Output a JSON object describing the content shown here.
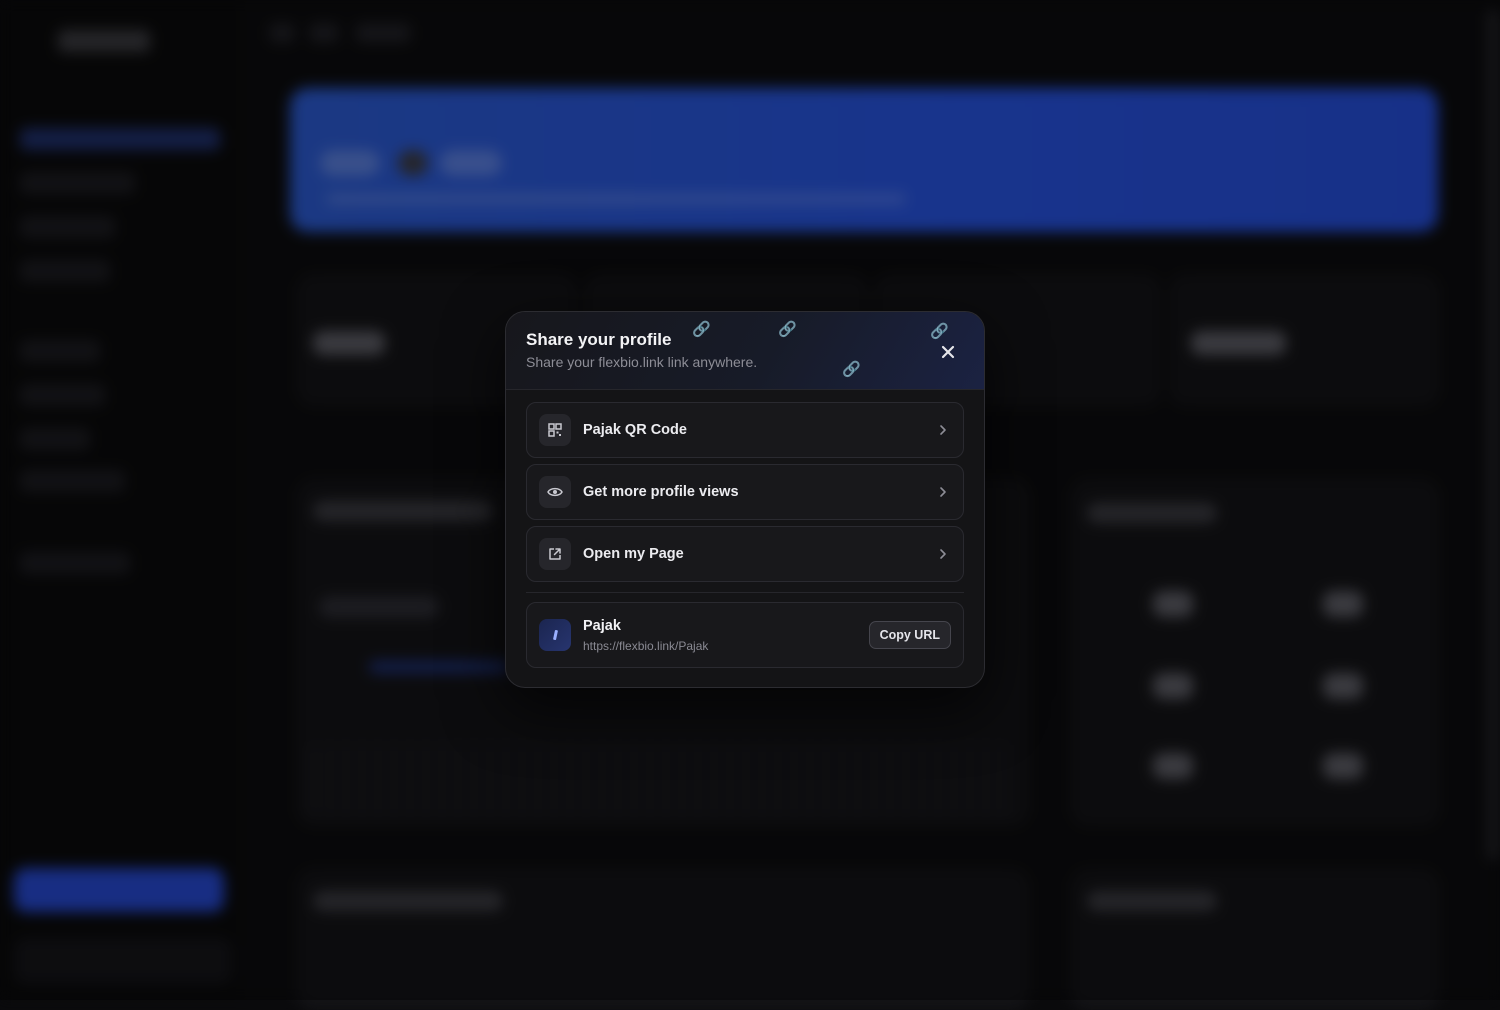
{
  "modal": {
    "title": "Share your profile",
    "subtitle": "Share your flexbio.link link anywhere.",
    "close_icon": "close-icon",
    "options": [
      {
        "label": "Pajak QR Code",
        "icon": "qr-code-icon"
      },
      {
        "label": "Get more profile views",
        "icon": "eye-icon"
      },
      {
        "label": "Open my Page",
        "icon": "external-link-icon"
      }
    ],
    "profile": {
      "name": "Pajak",
      "url": "https://flexbio.link/Pajak",
      "copy_label": "Copy URL"
    }
  },
  "colors": {
    "modal_bg": "#141416",
    "hero_blue": "#2550d8",
    "accent_blue": "#2546c9"
  }
}
